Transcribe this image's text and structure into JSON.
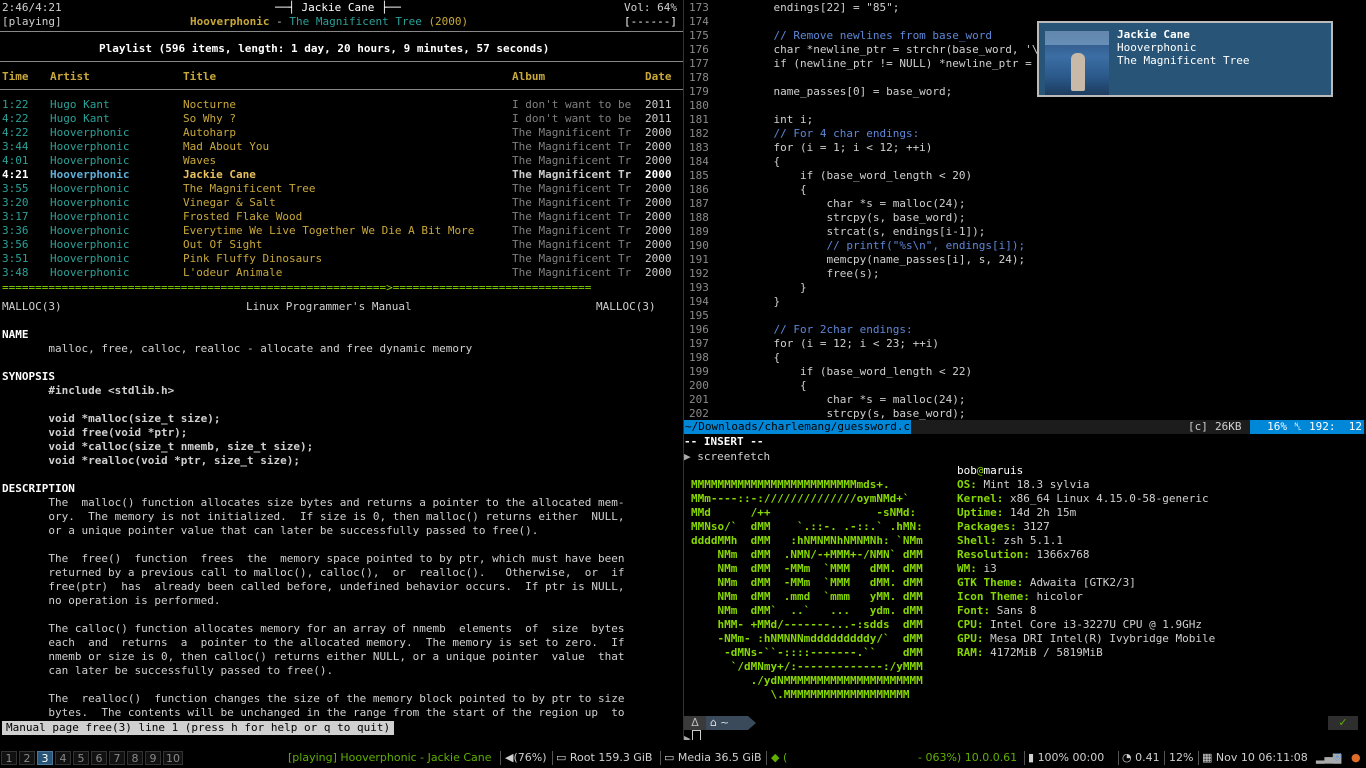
{
  "player": {
    "elapsed": "2:46/4:21",
    "status": "[playing]",
    "current_title": "Jackie Cane",
    "current_artist": "Hooverphonic",
    "current_album": "The Magnificent Tree",
    "current_year": "(2000)",
    "volume": "Vol: 64%",
    "mode_flags": "[------]",
    "playlist_header": "Playlist (596 items, length: 1 day, 20 hours, 9 minutes, 57 seconds)",
    "columns": [
      "Time",
      "Artist",
      "Title",
      "Album",
      "Date"
    ],
    "rows": [
      {
        "time": "1:22",
        "artist": "Hugo Kant",
        "title": "Nocturne",
        "album": "I don't want to be",
        "date": "2011"
      },
      {
        "time": "4:22",
        "artist": "Hugo Kant",
        "title": "So Why ?",
        "album": "I don't want to be",
        "date": "2011"
      },
      {
        "time": "4:22",
        "artist": "Hooverphonic",
        "title": "Autoharp",
        "album": "The Magnificent Tr",
        "date": "2000"
      },
      {
        "time": "3:44",
        "artist": "Hooverphonic",
        "title": "Mad About You",
        "album": "The Magnificent Tr",
        "date": "2000"
      },
      {
        "time": "4:01",
        "artist": "Hooverphonic",
        "title": "Waves",
        "album": "The Magnificent Tr",
        "date": "2000"
      },
      {
        "time": "4:21",
        "artist": "Hooverphonic",
        "title": "Jackie Cane",
        "album": "The Magnificent Tr",
        "date": "2000",
        "current": true
      },
      {
        "time": "3:55",
        "artist": "Hooverphonic",
        "title": "The Magnificent Tree",
        "album": "The Magnificent Tr",
        "date": "2000"
      },
      {
        "time": "3:20",
        "artist": "Hooverphonic",
        "title": "Vinegar & Salt",
        "album": "The Magnificent Tr",
        "date": "2000"
      },
      {
        "time": "3:17",
        "artist": "Hooverphonic",
        "title": "Frosted Flake Wood",
        "album": "The Magnificent Tr",
        "date": "2000"
      },
      {
        "time": "3:36",
        "artist": "Hooverphonic",
        "title": "Everytime We Live Together We Die A Bit More",
        "album": "The Magnificent Tr",
        "date": "2000"
      },
      {
        "time": "3:56",
        "artist": "Hooverphonic",
        "title": "Out Of Sight",
        "album": "The Magnificent Tr",
        "date": "2000"
      },
      {
        "time": "3:51",
        "artist": "Hooverphonic",
        "title": "Pink Fluffy Dinosaurs",
        "album": "The Magnificent Tr",
        "date": "2000"
      },
      {
        "time": "3:48",
        "artist": "Hooverphonic",
        "title": "L'odeur Animale",
        "album": "The Magnificent Tr",
        "date": "2000"
      }
    ],
    "progress_fraction": 0.64,
    "progress_text": "==========================================================>=============================="
  },
  "man": {
    "header_left": "MALLOC(3)",
    "header_center": "Linux Programmer's Manual",
    "header_right": "MALLOC(3)",
    "lines": [
      "",
      "NAME",
      "       malloc, free, calloc, realloc - allocate and free dynamic memory",
      "",
      "SYNOPSIS",
      "       #include <stdlib.h>",
      "",
      "       void *malloc(size_t size);",
      "       void free(void *ptr);",
      "       void *calloc(size_t nmemb, size_t size);",
      "       void *realloc(void *ptr, size_t size);",
      "",
      "DESCRIPTION",
      "       The  malloc() function allocates size bytes and returns a pointer to the allocated mem-",
      "       ory.  The memory is not initialized.  If size is 0, then malloc() returns either  NULL,",
      "       or a unique pointer value that can later be successfully passed to free().",
      "",
      "       The  free()  function  frees  the  memory space pointed to by ptr, which must have been",
      "       returned by a previous call to malloc(), calloc(),  or  realloc().   Otherwise,  or  if",
      "       free(ptr)  has  already been called before, undefined behavior occurs.  If ptr is NULL,",
      "       no operation is performed.",
      "",
      "       The calloc() function allocates memory for an array of nmemb  elements  of  size  bytes",
      "       each  and  returns  a  pointer to the allocated memory.  The memory is set to zero.  If",
      "       nmemb or size is 0, then calloc() returns either NULL, or a unique pointer  value  that",
      "       can later be successfully passed to free().",
      "",
      "       The  realloc()  function changes the size of the memory block pointed to by ptr to size",
      "       bytes.  The contents will be unchanged in the range from the start of the region up  to"
    ],
    "status": "Manual page free(3) line 1 (press h for help or q to quit)"
  },
  "editor": {
    "lines": [
      {
        "n": "173",
        "code": "    endings[22] = \"85\";"
      },
      {
        "n": "174",
        "code": ""
      },
      {
        "n": "175",
        "code": "    // Remove newlines from base_word"
      },
      {
        "n": "176",
        "code": "    char *newline_ptr = strchr(base_word, '\\n"
      },
      {
        "n": "177",
        "code": "    if (newline_ptr != NULL) *newline_ptr = '"
      },
      {
        "n": "178",
        "code": ""
      },
      {
        "n": "179",
        "code": "    name_passes[0] = base_word;"
      },
      {
        "n": "180",
        "code": ""
      },
      {
        "n": "181",
        "code": "    int i;"
      },
      {
        "n": "182",
        "code": "    // For 4 char endings:"
      },
      {
        "n": "183",
        "code": "    for (i = 1; i < 12; ++i)"
      },
      {
        "n": "184",
        "code": "    {"
      },
      {
        "n": "185",
        "code": "        if (base_word_length < 20)"
      },
      {
        "n": "186",
        "code": "        {"
      },
      {
        "n": "187",
        "code": "            char *s = malloc(24);"
      },
      {
        "n": "188",
        "code": "            strcpy(s, base_word);"
      },
      {
        "n": "189",
        "code": "            strcat(s, endings[i-1]);"
      },
      {
        "n": "190",
        "code": "            // printf(\"%s\\n\", endings[i]);"
      },
      {
        "n": "191",
        "code": "            memcpy(name_passes[i], s, 24);"
      },
      {
        "n": "192",
        "code": "            free(s);"
      },
      {
        "n": "193",
        "code": "        }"
      },
      {
        "n": "194",
        "code": "    }"
      },
      {
        "n": "195",
        "code": ""
      },
      {
        "n": "196",
        "code": "    // For 2char endings:"
      },
      {
        "n": "197",
        "code": "    for (i = 12; i < 23; ++i)"
      },
      {
        "n": "198",
        "code": "    {"
      },
      {
        "n": "199",
        "code": "        if (base_word_length < 22)"
      },
      {
        "n": "200",
        "code": "        {"
      },
      {
        "n": "201",
        "code": "            char *s = malloc(24);"
      },
      {
        "n": "202",
        "code": "            strcpy(s, base_word);"
      }
    ],
    "filename": "~/Downloads/charlemang/guessword.c",
    "filetype": "[c]",
    "filesize": "26KB",
    "position": "16% ␤ 192:  12",
    "mode": "-- INSERT --"
  },
  "terminal": {
    "prompt_cmd": "screenfetch",
    "logo": [
      "MMMMMMMMMMMMMMMMMMMMMMMMMmds+.",
      "MMm----::-://////////////oymNMd+`",
      "MMd      /++                -sNMd:",
      "MMNso/`  dMM    `.::-. .-::.` .hMN:",
      "ddddMMh  dMM   :hNMNMNhNMNMNh: `NMm",
      "    NMm  dMM  .NMN/-+MMM+-/NMN` dMM",
      "    NMm  dMM  -MMm  `MMM   dMM. dMM",
      "    NMm  dMM  -MMm  `MMM   dMM. dMM",
      "    NMm  dMM  .mmd  `mmm   yMM. dMM",
      "    NMm  dMM`  ..`   ...   ydm. dMM",
      "    hMM- +MMd/-------...-:sdds  dMM",
      "    -NMm- :hNMNNNmdddddddddy/`  dMM",
      "     -dMNs-``-::::-------.``    dMM",
      "      `/dMNmy+/:-------------:/yMMM",
      "         ./ydNMMMMMMMMMMMMMMMMMMMMM",
      "            \\.MMMMMMMMMMMMMMMMMMM"
    ],
    "user": "bob",
    "host": "maruis",
    "info": [
      {
        "k": "OS:",
        "v": "Mint 18.3 sylvia"
      },
      {
        "k": "Kernel:",
        "v": "x86_64 Linux 4.15.0-58-generic"
      },
      {
        "k": "Uptime:",
        "v": "14d 2h 15m"
      },
      {
        "k": "Packages:",
        "v": "3127"
      },
      {
        "k": "Shell:",
        "v": "zsh 5.1.1"
      },
      {
        "k": "Resolution:",
        "v": "1366x768"
      },
      {
        "k": "WM:",
        "v": "i3"
      },
      {
        "k": "GTK Theme:",
        "v": "Adwaita [GTK2/3]"
      },
      {
        "k": "Icon Theme:",
        "v": "hicolor"
      },
      {
        "k": "Font:",
        "v": "Sans 8"
      },
      {
        "k": "CPU:",
        "v": "Intel Core i3-3227U CPU @ 1.9GHz"
      },
      {
        "k": "GPU:",
        "v": "Mesa DRI Intel(R) Ivybridge Mobile"
      },
      {
        "k": "RAM:",
        "v": "4172MiB / 5819MiB"
      }
    ],
    "prompt_dir": "~",
    "check": "✓"
  },
  "notification": {
    "title": "Jackie Cane",
    "artist": "Hooverphonic",
    "album": "The Magnificent Tree"
  },
  "bar": {
    "workspaces": [
      "1",
      "2",
      "3",
      "4",
      "5",
      "6",
      "7",
      "8",
      "9",
      "10"
    ],
    "active_workspace": "3",
    "now_playing": "[playing] Hooverphonic - Jackie Cane",
    "volume": "(76%)",
    "root": "Root 159.3 GiB",
    "media": "Media 36.5 GiB",
    "wifi": "(",
    "net": "- 063%) 10.0.0.61",
    "battery": "100% 00:00",
    "load": "0.41",
    "cpu": "12%",
    "datetime": "Nov 10 06:11:08"
  },
  "colors": {
    "accent": "#285577",
    "teal": "#2aa198",
    "gold": "#c8a83a",
    "lime": "#87d700",
    "cursor_bar": "#0087d7"
  }
}
